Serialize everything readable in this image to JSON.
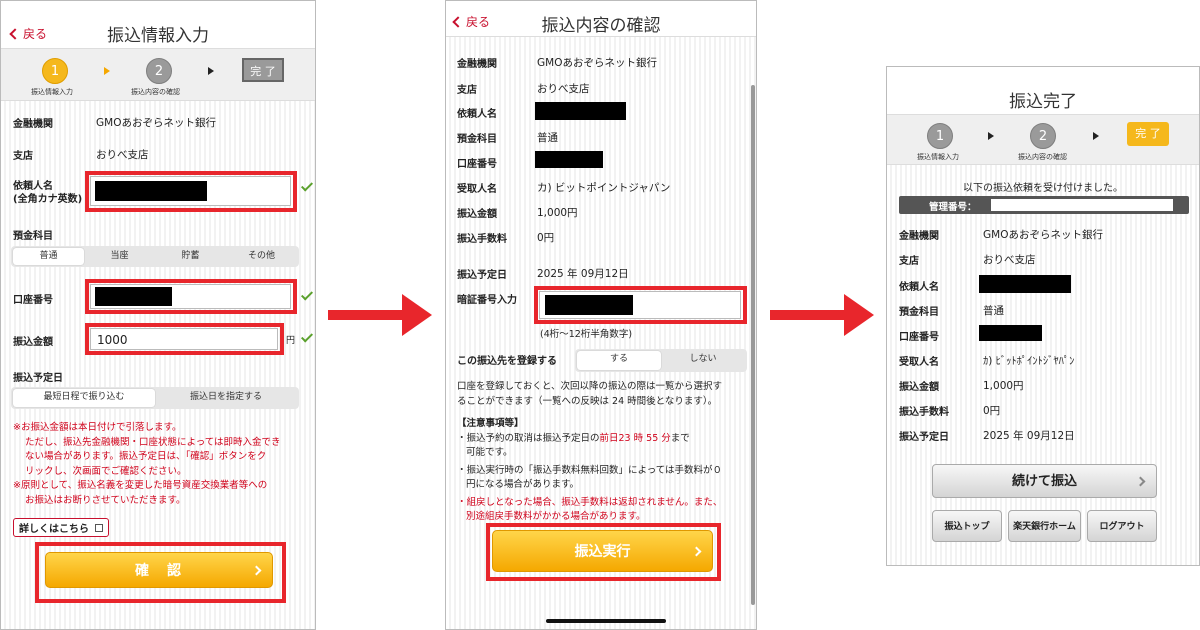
{
  "screen1": {
    "back": "戻る",
    "title": "振込情報入力",
    "steps": {
      "s1_num": "1",
      "s1_label": "振込情報入力",
      "s2_num": "2",
      "s2_label": "振込内容の確認",
      "done": "完 了"
    },
    "bank_label": "金融機関",
    "bank_value": "GMOあおぞらネット銀行",
    "branch_label": "支店",
    "branch_value": "おりべ支店",
    "requester_label": "依頼人名",
    "requester_sub": "(全角カナ英数)",
    "deposit_label": "預金科目",
    "deposit_options": [
      "普通",
      "当座",
      "貯蓄",
      "その他"
    ],
    "account_label": "口座番号",
    "amount_label": "振込金額",
    "amount_value": "1000",
    "amount_unit": "円",
    "date_label": "振込予定日",
    "date_options": [
      "最短日程で振り込む",
      "振込日を指定する"
    ],
    "notes": [
      "※お振込金額は本日付けで引落します。",
      "ただし、振込先金融機関・口座状態によっては即時入金でき",
      "ない場合があります。振込予定日は、「確認」ボタンをク",
      "リックし、次画面でご確認ください。",
      "※原則として、振込名義を変更した暗号資産交換業者等への",
      "お振込はお断りさせていただきます。"
    ],
    "details_link": "詳しくはこちら",
    "confirm_button": "確　認"
  },
  "screen2": {
    "back": "戻る",
    "title": "振込内容の確認",
    "bank_label": "金融機関",
    "bank_value": "GMOあおぞらネット銀行",
    "branch_label": "支店",
    "branch_value": "おりべ支店",
    "requester_label": "依頼人名",
    "deposit_label": "預金科目",
    "deposit_value": "普通",
    "account_label": "口座番号",
    "recipient_label": "受取人名",
    "recipient_value": "カ) ビットポイントジャパン",
    "amount_label": "振込金額",
    "amount_value": "1,000円",
    "fee_label": "振込手数料",
    "fee_value": "0円",
    "date_label": "振込予定日",
    "date_value": "2025 年 09月12日",
    "pin_label": "暗証番号入力",
    "pin_hint": "(4桁〜12桁半角数字)",
    "register_label": "この振込先を登録する",
    "register_options": [
      "する",
      "しない"
    ],
    "register_note": [
      "口座を登録しておくと、次回以降の振込の際は一覧から選択す",
      "ることができます（一覧への反映は 24 時間後となります）。"
    ],
    "caution_title": "【注意事項等】",
    "caution1_a": "・振込予約の取消は振込予定日の",
    "caution1_red": "前日23 時 55 分",
    "caution1_b": "まで",
    "caution1_c": "可能です。",
    "caution2": [
      "・振込実行時の「振込手数料無料回数」によっては手数料が０",
      "円になる場合があります。"
    ],
    "caution3": [
      "・組戻しとなった場合、振込手数料は返却されません。また、",
      "別途組戻手数料がかかる場合があります。"
    ],
    "execute_button": "振込実行"
  },
  "screen3": {
    "title": "振込完了",
    "steps": {
      "s1_num": "1",
      "s1_label": "振込情報入力",
      "s2_num": "2",
      "s2_label": "振込内容の確認",
      "done": "完 了"
    },
    "accepted_msg": "以下の振込依頼を受け付けました。",
    "mgmt_label": "管理番号：",
    "bank_label": "金融機関",
    "bank_value": "GMOあおぞらネット銀行",
    "branch_label": "支店",
    "branch_value": "おりべ支店",
    "requester_label": "依頼人名",
    "deposit_label": "預金科目",
    "deposit_value": "普通",
    "account_label": "口座番号",
    "recipient_label": "受取人名",
    "recipient_value": "ｶ) ﾋﾞｯﾄﾎﾟｲﾝﾄｼﾞﾔﾊﾟﾝ",
    "amount_label": "振込金額",
    "amount_value": "1,000円",
    "fee_label": "振込手数料",
    "fee_value": "0円",
    "date_label": "振込予定日",
    "date_value": "2025 年 09月12日",
    "continue_button": "続けて振込",
    "btn_top": "振込トップ",
    "btn_home": "楽天銀行ホーム",
    "btn_logout": "ログアウト"
  },
  "colors": {
    "accent_red": "#e8262c",
    "step_orange": "#f5b81c",
    "back_red": "#c8102e"
  }
}
